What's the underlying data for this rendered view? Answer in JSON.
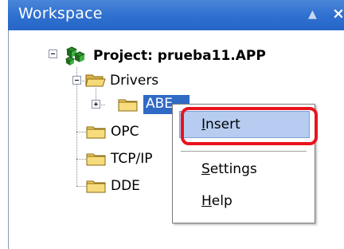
{
  "window": {
    "title": "Workspace",
    "pin_glyph": "▲",
    "close_glyph": "×"
  },
  "tree": {
    "project": "Project: prueba11.APP",
    "drivers": "Drivers",
    "abe_driver": "ABE",
    "opc": "OPC",
    "tcpip": "TCP/IP",
    "dde": "DDE"
  },
  "context_menu": {
    "insert": "Insert",
    "settings": "Settings",
    "help": "Help"
  },
  "colors": {
    "titlebar": "#2d6fcf",
    "selection": "#316ac5",
    "highlight_ring": "#e8141f",
    "menu_hover": "#b6cdf1"
  },
  "icons": [
    "project-icon",
    "folder-icon",
    "open-folder-icon",
    "expand-icon",
    "collapse-icon",
    "close-icon",
    "pin-icon"
  ]
}
